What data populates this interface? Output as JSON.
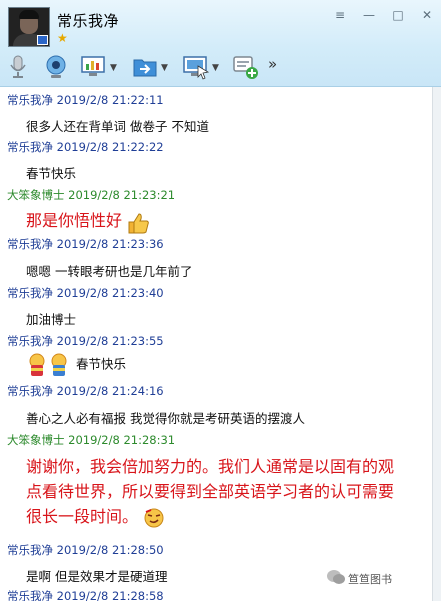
{
  "window": {
    "title": "常乐我净",
    "star": "★",
    "controls": {
      "menu": "≡",
      "minimize": "—",
      "maximize": "□",
      "close": "✕"
    }
  },
  "toolbar": {
    "more": "»",
    "icons": [
      "microphone-icon",
      "camera-icon",
      "screen-share-icon",
      "file-transfer-icon",
      "remote-desktop-icon",
      "add-app-icon"
    ]
  },
  "messages": [
    {
      "sender": "常乐我净",
      "time": "2019/2/8 21:22:11",
      "text": "很多人还在背单词 做卷子 不知道"
    },
    {
      "sender": "常乐我净",
      "time": "2019/2/8 21:22:22",
      "text": "春节快乐"
    },
    {
      "sender": "大笨象博士",
      "time": "2019/2/8 21:23:21",
      "text": "那是你悟性好"
    },
    {
      "sender": "常乐我净",
      "time": "2019/2/8 21:23:36",
      "text": "嗯嗯 一转眼考研也是几年前了"
    },
    {
      "sender": "常乐我净",
      "time": "2019/2/8 21:23:40",
      "text": "加油博士"
    },
    {
      "sender": "常乐我净",
      "time": "2019/2/8 21:23:55",
      "text": "春节快乐"
    },
    {
      "sender": "常乐我净",
      "time": "2019/2/8 21:24:16",
      "text": "善心之人必有福报 我觉得你就是考研英语的摆渡人"
    },
    {
      "sender": "大笨象博士",
      "time": "2019/2/8 21:28:31",
      "lines": [
        "谢谢你，我会倍加努力的。我们人通常是以固有的观",
        "点看待世界，所以要得到全部英语学习者的认可需要",
        "很长一段时间。"
      ]
    },
    {
      "sender": "常乐我净",
      "time": "2019/2/8 21:28:50",
      "text": "是啊 但是效果才是硬道理"
    },
    {
      "sender": "常乐我净",
      "time": "2019/2/8 21:28:58",
      "text": ""
    }
  ],
  "watermark": "笪笪图书",
  "colors": {
    "self": "#1f3e96",
    "peer": "#2c8a2c",
    "peer_text": "#d8141a"
  }
}
